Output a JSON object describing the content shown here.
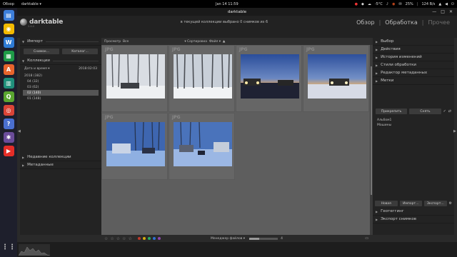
{
  "topbar": {
    "activities": "Обзор",
    "app_name": "darktable",
    "clock": "Jan 14  11:59",
    "tray": [
      "-5°C",
      "25%",
      "124 B/s"
    ],
    "menu_glyph": "▾"
  },
  "window": {
    "title": "darktable"
  },
  "header": {
    "logo": "darktable",
    "version": "2.4.0",
    "status": "в текущей коллекции выбрано 0 снимков из 6",
    "views": [
      "Обзор",
      "Обработка",
      "Прочее"
    ],
    "separator": "|"
  },
  "left_panel": {
    "import_label": "Импорт",
    "import_buttons": [
      "Снимок...",
      "Каталог..."
    ],
    "collections_label": "Коллекции",
    "filter_field": "Дата и время",
    "filter_value": "2018:02:03",
    "collection_items": [
      {
        "label": "2018 (382)",
        "level": 0,
        "selected": false
      },
      {
        "label": "04 (32)",
        "level": 1,
        "selected": false
      },
      {
        "label": "03 (62)",
        "level": 1,
        "selected": false
      },
      {
        "label": "02 (140)",
        "level": 1,
        "selected": true
      },
      {
        "label": "01 (148)",
        "level": 1,
        "selected": false
      }
    ],
    "recent_label": "Недавние коллекции",
    "metadata_label": "Метаданные"
  },
  "center": {
    "view_label": "Просмотр",
    "view_value": "Все",
    "sort_label": "Сортировка",
    "sort_value": "Файл",
    "thumbs": [
      {
        "format": "JPG",
        "scene": "forest-snow"
      },
      {
        "format": "JPG",
        "scene": "forest-snow2"
      },
      {
        "format": "JPG",
        "scene": "dusk-lights"
      },
      {
        "format": "JPG",
        "scene": "dusk-lights2"
      },
      {
        "format": "JPG",
        "scene": "blue-camp"
      },
      {
        "format": "JPG",
        "scene": "blue-truck"
      }
    ]
  },
  "bottombar": {
    "stars": [
      "☆",
      "☆",
      "☆",
      "☆",
      "☆"
    ],
    "color_labels": [
      "#c0392b",
      "#d4ac0d",
      "#27ae60",
      "#2e6fd6",
      "#8e44ad"
    ],
    "layout_label": "Менеджер файлов",
    "zoom_value": "4",
    "zoom_fraction": 0.35
  },
  "right_panel": {
    "sections_top": [
      "Выбор",
      "Действия",
      "История изменений",
      "Стили обработки",
      "Редактор метаданных",
      "Метки"
    ],
    "tag_buttons": [
      "Прикрепить",
      "Снять"
    ],
    "tags": [
      "Альбом1",
      "Машины"
    ],
    "bottom_buttons": [
      "Новая",
      "Импорт...",
      "Экспорт..."
    ],
    "sections_bottom": [
      "Геотеггинг",
      "Экспорт снимков"
    ]
  },
  "dock": {
    "icons": [
      {
        "name": "files-icon",
        "color": "#3d7edb",
        "glyph": "▤"
      },
      {
        "name": "rhythmbox-icon",
        "color": "#f2b900",
        "glyph": "◉"
      },
      {
        "name": "writer-icon",
        "color": "#2e7bd6",
        "glyph": "W"
      },
      {
        "name": "calc-icon",
        "color": "#1e9b47",
        "glyph": "▦"
      },
      {
        "name": "software-icon",
        "color": "#e8642c",
        "glyph": "A"
      },
      {
        "name": "impress-icon",
        "color": "#1f8f7b",
        "glyph": "▥"
      },
      {
        "name": "qgis-icon",
        "color": "#5aa630",
        "glyph": "Q"
      },
      {
        "name": "chrome-icon",
        "color": "#db4437",
        "glyph": "◎"
      },
      {
        "name": "help-icon",
        "color": "#4a6fd1",
        "glyph": "?"
      },
      {
        "name": "darktable-icon",
        "color": "#6b4c9a",
        "glyph": "✱"
      },
      {
        "name": "youtube-icon",
        "color": "#e52d27",
        "glyph": "▶"
      }
    ]
  }
}
